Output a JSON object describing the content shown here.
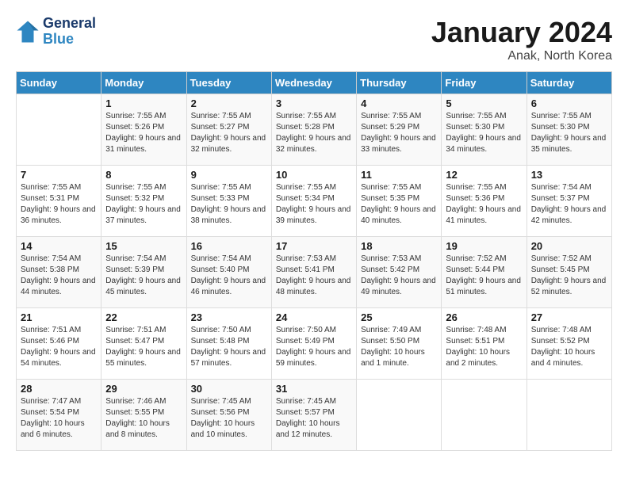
{
  "header": {
    "logo_line1": "General",
    "logo_line2": "Blue",
    "title": "January 2024",
    "subtitle": "Anak, North Korea"
  },
  "days_of_week": [
    "Sunday",
    "Monday",
    "Tuesday",
    "Wednesday",
    "Thursday",
    "Friday",
    "Saturday"
  ],
  "weeks": [
    [
      {
        "day": "",
        "info": ""
      },
      {
        "day": "1",
        "info": "Sunrise: 7:55 AM\nSunset: 5:26 PM\nDaylight: 9 hours\nand 31 minutes."
      },
      {
        "day": "2",
        "info": "Sunrise: 7:55 AM\nSunset: 5:27 PM\nDaylight: 9 hours\nand 32 minutes."
      },
      {
        "day": "3",
        "info": "Sunrise: 7:55 AM\nSunset: 5:28 PM\nDaylight: 9 hours\nand 32 minutes."
      },
      {
        "day": "4",
        "info": "Sunrise: 7:55 AM\nSunset: 5:29 PM\nDaylight: 9 hours\nand 33 minutes."
      },
      {
        "day": "5",
        "info": "Sunrise: 7:55 AM\nSunset: 5:30 PM\nDaylight: 9 hours\nand 34 minutes."
      },
      {
        "day": "6",
        "info": "Sunrise: 7:55 AM\nSunset: 5:30 PM\nDaylight: 9 hours\nand 35 minutes."
      }
    ],
    [
      {
        "day": "7",
        "info": "Sunrise: 7:55 AM\nSunset: 5:31 PM\nDaylight: 9 hours\nand 36 minutes."
      },
      {
        "day": "8",
        "info": "Sunrise: 7:55 AM\nSunset: 5:32 PM\nDaylight: 9 hours\nand 37 minutes."
      },
      {
        "day": "9",
        "info": "Sunrise: 7:55 AM\nSunset: 5:33 PM\nDaylight: 9 hours\nand 38 minutes."
      },
      {
        "day": "10",
        "info": "Sunrise: 7:55 AM\nSunset: 5:34 PM\nDaylight: 9 hours\nand 39 minutes."
      },
      {
        "day": "11",
        "info": "Sunrise: 7:55 AM\nSunset: 5:35 PM\nDaylight: 9 hours\nand 40 minutes."
      },
      {
        "day": "12",
        "info": "Sunrise: 7:55 AM\nSunset: 5:36 PM\nDaylight: 9 hours\nand 41 minutes."
      },
      {
        "day": "13",
        "info": "Sunrise: 7:54 AM\nSunset: 5:37 PM\nDaylight: 9 hours\nand 42 minutes."
      }
    ],
    [
      {
        "day": "14",
        "info": "Sunrise: 7:54 AM\nSunset: 5:38 PM\nDaylight: 9 hours\nand 44 minutes."
      },
      {
        "day": "15",
        "info": "Sunrise: 7:54 AM\nSunset: 5:39 PM\nDaylight: 9 hours\nand 45 minutes."
      },
      {
        "day": "16",
        "info": "Sunrise: 7:54 AM\nSunset: 5:40 PM\nDaylight: 9 hours\nand 46 minutes."
      },
      {
        "day": "17",
        "info": "Sunrise: 7:53 AM\nSunset: 5:41 PM\nDaylight: 9 hours\nand 48 minutes."
      },
      {
        "day": "18",
        "info": "Sunrise: 7:53 AM\nSunset: 5:42 PM\nDaylight: 9 hours\nand 49 minutes."
      },
      {
        "day": "19",
        "info": "Sunrise: 7:52 AM\nSunset: 5:44 PM\nDaylight: 9 hours\nand 51 minutes."
      },
      {
        "day": "20",
        "info": "Sunrise: 7:52 AM\nSunset: 5:45 PM\nDaylight: 9 hours\nand 52 minutes."
      }
    ],
    [
      {
        "day": "21",
        "info": "Sunrise: 7:51 AM\nSunset: 5:46 PM\nDaylight: 9 hours\nand 54 minutes."
      },
      {
        "day": "22",
        "info": "Sunrise: 7:51 AM\nSunset: 5:47 PM\nDaylight: 9 hours\nand 55 minutes."
      },
      {
        "day": "23",
        "info": "Sunrise: 7:50 AM\nSunset: 5:48 PM\nDaylight: 9 hours\nand 57 minutes."
      },
      {
        "day": "24",
        "info": "Sunrise: 7:50 AM\nSunset: 5:49 PM\nDaylight: 9 hours\nand 59 minutes."
      },
      {
        "day": "25",
        "info": "Sunrise: 7:49 AM\nSunset: 5:50 PM\nDaylight: 10 hours\nand 1 minute."
      },
      {
        "day": "26",
        "info": "Sunrise: 7:48 AM\nSunset: 5:51 PM\nDaylight: 10 hours\nand 2 minutes."
      },
      {
        "day": "27",
        "info": "Sunrise: 7:48 AM\nSunset: 5:52 PM\nDaylight: 10 hours\nand 4 minutes."
      }
    ],
    [
      {
        "day": "28",
        "info": "Sunrise: 7:47 AM\nSunset: 5:54 PM\nDaylight: 10 hours\nand 6 minutes."
      },
      {
        "day": "29",
        "info": "Sunrise: 7:46 AM\nSunset: 5:55 PM\nDaylight: 10 hours\nand 8 minutes."
      },
      {
        "day": "30",
        "info": "Sunrise: 7:45 AM\nSunset: 5:56 PM\nDaylight: 10 hours\nand 10 minutes."
      },
      {
        "day": "31",
        "info": "Sunrise: 7:45 AM\nSunset: 5:57 PM\nDaylight: 10 hours\nand 12 minutes."
      },
      {
        "day": "",
        "info": ""
      },
      {
        "day": "",
        "info": ""
      },
      {
        "day": "",
        "info": ""
      }
    ]
  ]
}
